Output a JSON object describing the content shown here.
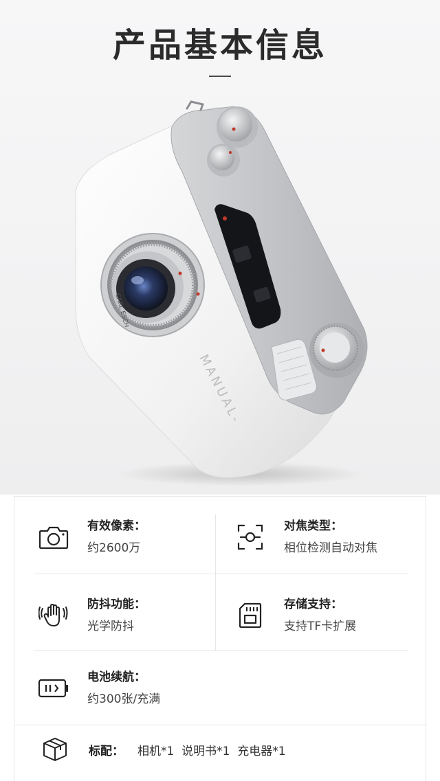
{
  "header": {
    "title": "产品基本信息"
  },
  "specs": {
    "resolution": {
      "label": "有效像素：",
      "value": "约2600万",
      "icon": "camera-icon"
    },
    "focus": {
      "label": "对焦类型：",
      "value": "相位检测自动对焦",
      "icon": "focus-frame-icon"
    },
    "stabilization": {
      "label": "防抖功能：",
      "value": "光学防抖",
      "icon": "hand-shake-icon"
    },
    "storage": {
      "label": "存储支持：",
      "value": "支持TF卡扩展",
      "icon": "sd-card-icon"
    },
    "battery": {
      "label": "电池续航：",
      "value": "约300张/充满",
      "icon": "battery-icon"
    }
  },
  "accessories": {
    "label": "标配：",
    "items": "相机*1  说明书*1  充电器*1",
    "icon": "box-icon"
  },
  "camera_markings": {
    "brand": "MANUAL-",
    "lens": "CARL ESCH"
  }
}
